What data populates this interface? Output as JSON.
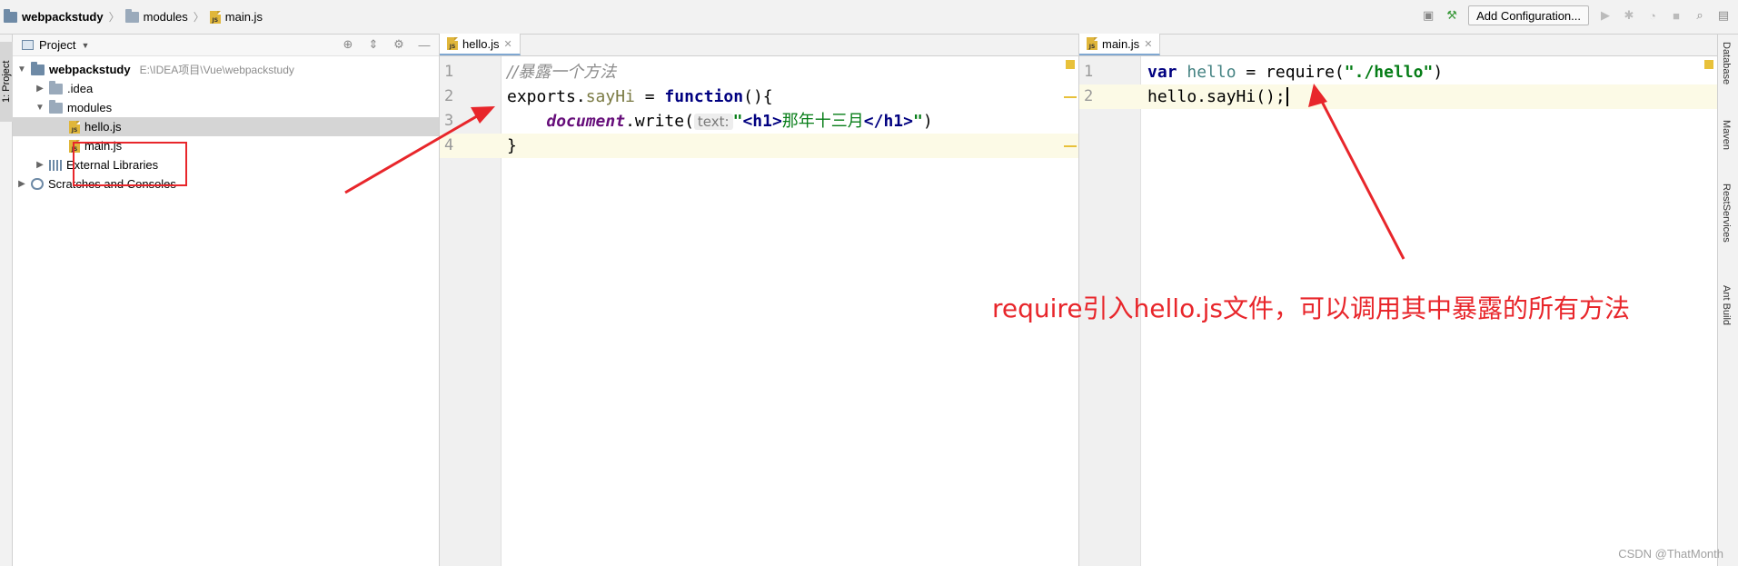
{
  "breadcrumbs": {
    "project": "webpackstudy",
    "folder": "modules",
    "file": "main.js"
  },
  "toolbar": {
    "add_config": "Add Configuration..."
  },
  "left_tool_window": {
    "label": "1: Project"
  },
  "project_panel": {
    "title": "Project",
    "root": {
      "name": "webpackstudy",
      "path": "E:\\IDEA项目\\Vue\\webpackstudy"
    },
    "items": {
      "idea": ".idea",
      "modules": "modules",
      "hello": "hello.js",
      "main": "main.js",
      "ext": "External Libraries",
      "scratch": "Scratches and Consoles"
    }
  },
  "editor_left": {
    "tab": "hello.js",
    "line_numbers": [
      "1",
      "2",
      "3",
      "4"
    ],
    "l1": "//暴露一个方法",
    "l2a": "exports.",
    "l2b": "sayHi",
    "l2c": " = ",
    "l2d": "function",
    "l2e": "(){",
    "l3a": "    ",
    "l3b": "document",
    "l3c": ".write(",
    "l3hint": "text:",
    "l3q1": "\"",
    "l3t1": "<h1>",
    "l3txt": "那年十三月",
    "l3t2": "</h1>",
    "l3q2": "\"",
    "l3end": ")",
    "l4": "}"
  },
  "editor_right": {
    "tab": "main.js",
    "line_numbers": [
      "1",
      "2"
    ],
    "l1a": "var",
    "l1b": " hello",
    "l1c": " = require(",
    "l1d": "\"./hello\"",
    "l1e": ")",
    "l2": "hello.sayHi();"
  },
  "right_tool_window": {
    "database": "Database",
    "maven": "Maven",
    "rest": "RestServices",
    "ant": "Ant Build"
  },
  "annotation": "require引入hello.js文件，可以调用其中暴露的所有方法",
  "watermark": "CSDN @ThatMonth",
  "colors": {
    "annotation": "#e8262b",
    "keyword": "#000080",
    "string": "#067d17",
    "comment": "#8c8c8c"
  }
}
